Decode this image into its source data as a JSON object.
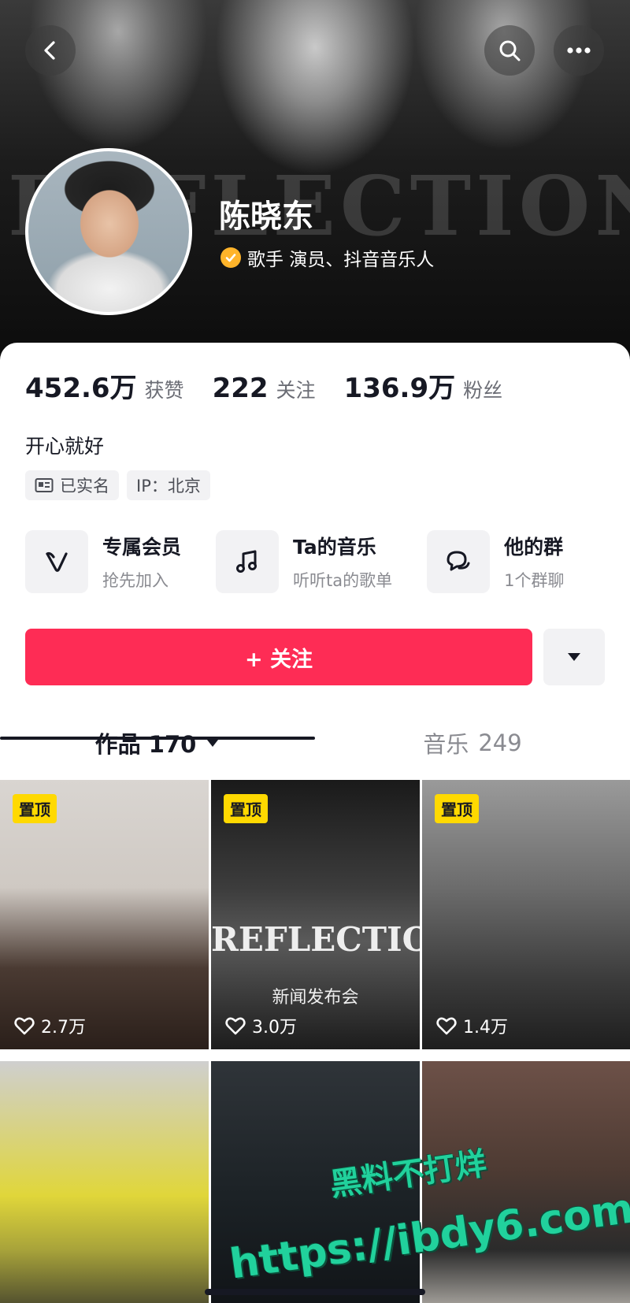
{
  "header": {
    "banner_word": "REFLECTION",
    "name": "陈晓东",
    "verification": "歌手 演员、抖音音乐人"
  },
  "stats": [
    {
      "num": "452.6万",
      "label": "获赞"
    },
    {
      "num": "222",
      "label": "关注"
    },
    {
      "num": "136.9万",
      "label": "粉丝"
    }
  ],
  "bio": "开心就好",
  "tags": [
    "已实名",
    "IP：北京"
  ],
  "features": [
    {
      "icon": "heart-v-icon",
      "title": "专属会员",
      "sub": "抢先加入"
    },
    {
      "icon": "music-note-icon",
      "title": "Ta的音乐",
      "sub": "听听ta的歌单"
    },
    {
      "icon": "chat-bubble-icon",
      "title": "他的群",
      "sub": "1个群聊"
    }
  ],
  "follow_label": "+ 关注",
  "tabs": {
    "works": "作品 170",
    "music": "音乐",
    "music_count": "249"
  },
  "grid": [
    {
      "pinned": true,
      "pin_label": "置顶",
      "likes": "2.7万"
    },
    {
      "pinned": true,
      "pin_label": "置顶",
      "likes": "3.0万",
      "art_title": "REFLECTION",
      "art_sub": "新闻发布会"
    },
    {
      "pinned": true,
      "pin_label": "置顶",
      "likes": "1.4万"
    },
    {
      "pinned": false
    },
    {
      "pinned": false
    },
    {
      "pinned": false
    }
  ],
  "watermark": {
    "line1": "黑料不打烊",
    "line2": "https://ibdy6.com"
  },
  "colors": {
    "accent": "#fe2c55",
    "verify": "#ffb42a",
    "pin": "#ffd900"
  }
}
